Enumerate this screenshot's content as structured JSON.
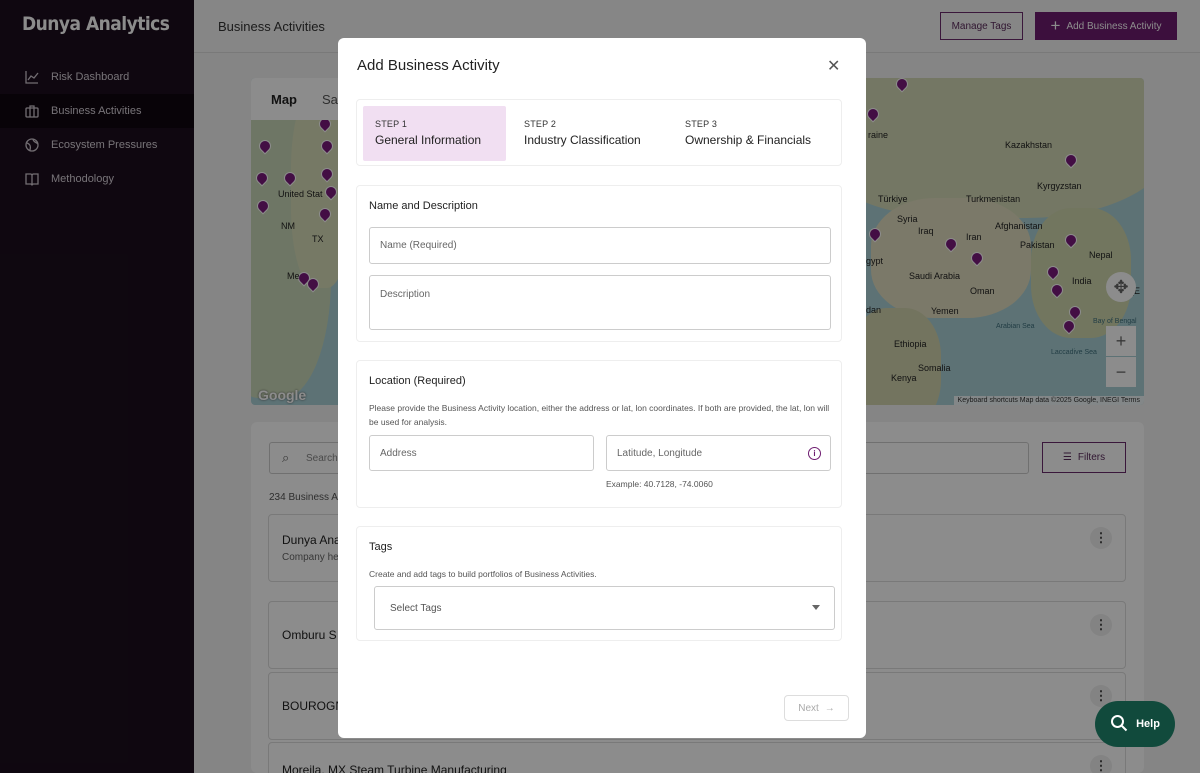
{
  "sidebar": {
    "brand": "Dunya Analytics",
    "items": [
      {
        "label": "Risk Dashboard",
        "icon": "chart-icon"
      },
      {
        "label": "Business Activities",
        "icon": "briefcase-icon"
      },
      {
        "label": "Ecosystem Pressures",
        "icon": "globe-icon"
      },
      {
        "label": "Methodology",
        "icon": "book-icon"
      }
    ]
  },
  "header": {
    "title": "Business Activities",
    "manage_tags": "Manage Tags",
    "add_activity": "Add Business Activity"
  },
  "map": {
    "toggle_map": "Map",
    "toggle_satellite": "Sa",
    "labels": [
      "United Stat",
      "NM",
      "TX",
      "Me",
      "raine",
      "Kazakhstan",
      "Kyrgyzstan",
      "Türkiye",
      "Turkmenistan",
      "Syria",
      "Iraq",
      "Afghanistan",
      "Iran",
      "Pakistan",
      "Nepal",
      "gypt",
      "Saudi Arabia",
      "India",
      "Oman",
      "dan",
      "Yemen",
      "Arabian Sea",
      "Bay of Bengal",
      "Ethiopia",
      "Somalia",
      "Kenya",
      "Laccadive Sea",
      "(E"
    ],
    "attribution": "Keyboard shortcuts    Map data ©2025 Google, INEGI    Terms",
    "google": "Google"
  },
  "list": {
    "search_placeholder": "Search",
    "filters": "Filters",
    "count": "234 Business A",
    "cards": [
      {
        "title": "Dunya Ana",
        "subtitle": "Company he"
      },
      {
        "title": "Omburu S",
        "subtitle": ""
      },
      {
        "title": "BOUROGN",
        "subtitle": ""
      },
      {
        "title": "Moreila, MX Steam Turbine Manufacturing",
        "subtitle": ""
      }
    ]
  },
  "help": "Help",
  "modal": {
    "title": "Add Business Activity",
    "steps": [
      {
        "number": "STEP 1",
        "label": "General Information"
      },
      {
        "number": "STEP 2",
        "label": "Industry Classification"
      },
      {
        "number": "STEP 3",
        "label": "Ownership & Financials"
      }
    ],
    "name_section": {
      "title": "Name and Description",
      "name_placeholder": "Name (Required)",
      "description_placeholder": "Description"
    },
    "location_section": {
      "title": "Location (Required)",
      "hint": "Please provide the Business Activity location, either the address or lat, lon coordinates. If both are provided, the lat, lon will be used for analysis.",
      "address_placeholder": "Address",
      "latlon_placeholder": "Latitude, Longitude",
      "example": "Example: 40.7128, -74.0060"
    },
    "tags_section": {
      "title": "Tags",
      "hint": "Create and add tags to build portfolios of Business Activities.",
      "select_placeholder": "Select Tags"
    },
    "next": "Next"
  },
  "colors": {
    "accent": "#6e1c70",
    "sidebar_bg": "#1c0e1e",
    "help_bg": "#114a3c"
  }
}
